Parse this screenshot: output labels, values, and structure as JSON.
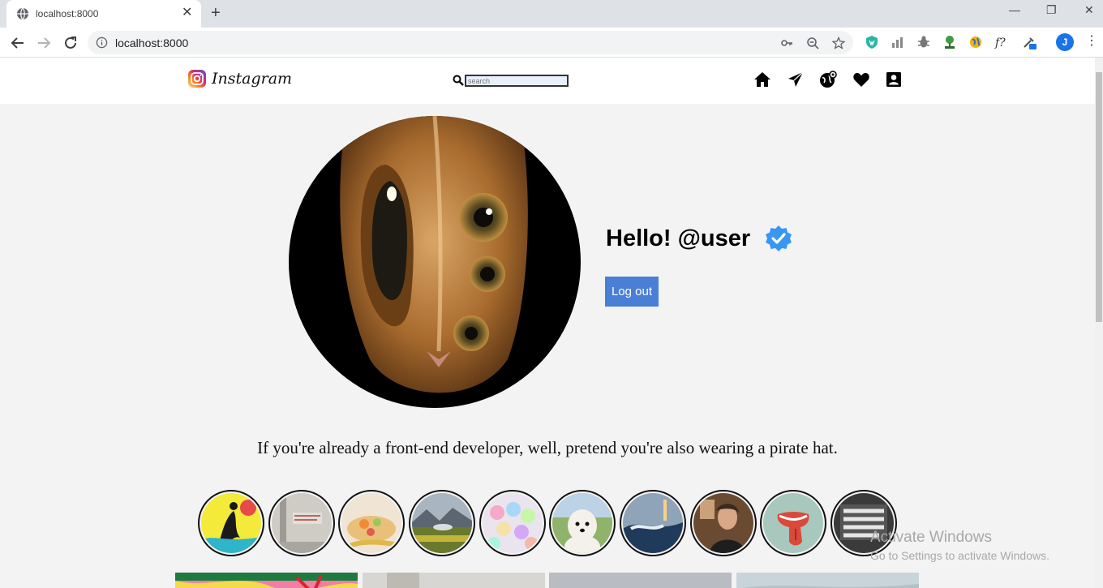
{
  "browser": {
    "tab_title": "localhost:8000",
    "tab_close": "✕",
    "new_tab": "+",
    "window_minimize": "—",
    "window_restore": "❐",
    "window_close": "✕",
    "url": "localhost:8000",
    "profile_initial": "J",
    "menu": "⋮"
  },
  "site": {
    "brand": "Instagram",
    "search_placeholder": "search",
    "nav_icons": [
      "home-icon",
      "direct-send-icon",
      "explore-icon",
      "activity-heart-icon",
      "profile-icon"
    ]
  },
  "profile": {
    "greeting": "Hello! @user",
    "logout_label": "Log out",
    "bio": "If you're already a front-end developer, well, pretend you're also wearing a pirate hat."
  },
  "stories": [
    {
      "name": "story-surfer"
    },
    {
      "name": "story-wall-sign"
    },
    {
      "name": "story-food"
    },
    {
      "name": "story-field"
    },
    {
      "name": "story-balloons"
    },
    {
      "name": "story-dog"
    },
    {
      "name": "story-wave"
    },
    {
      "name": "story-portrait"
    },
    {
      "name": "story-rolling-tongue"
    },
    {
      "name": "story-turn-off-news"
    }
  ],
  "os_watermark": {
    "line1": "Activate Windows",
    "line2": "Go to Settings to activate Windows."
  },
  "colors": {
    "accent_button": "#4a7fd6",
    "verified": "#3897f0",
    "page_bg": "#f3f3f3"
  }
}
